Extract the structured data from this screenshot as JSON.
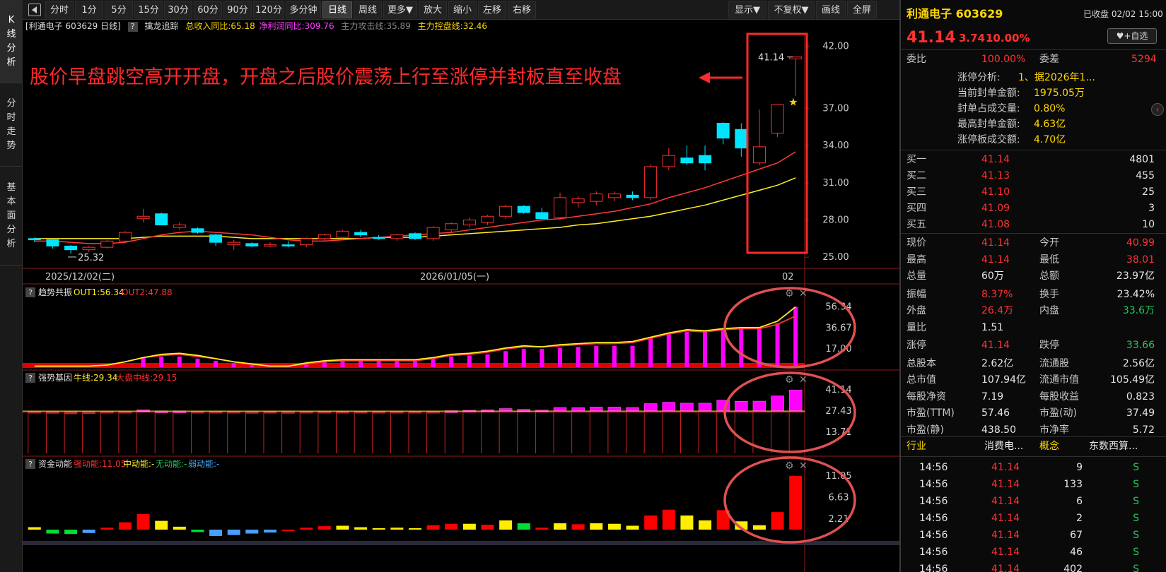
{
  "left_tabs": [
    {
      "label": "K线分析",
      "chars": [
        "K",
        "线",
        "分",
        "析"
      ]
    },
    {
      "label": "分时走势",
      "chars": [
        "分",
        "时",
        "走",
        "势"
      ]
    },
    {
      "label": "基本面分析",
      "chars": [
        "基",
        "本",
        "面",
        "分",
        "析"
      ]
    }
  ],
  "toolbar": {
    "periods": [
      "分时",
      "1分",
      "5分",
      "15分",
      "30分",
      "60分",
      "90分",
      "120分",
      "多分钟",
      "日线",
      "周线",
      "更多▼"
    ],
    "active_period": "日线",
    "actions": [
      "放大",
      "缩小",
      "左移",
      "右移"
    ],
    "right": [
      "显示▼",
      "不复权▼",
      "画线",
      "全屏"
    ]
  },
  "info_line": {
    "stock_tag": "[利通电子 603629 日线]",
    "indicator": "擒龙追踪",
    "revenue_yoy": "总收入同比:65.18",
    "profit_yoy": "净利润同比:309.76",
    "attack_line": "主力攻击线:35.89",
    "control_line": "主力控盘线:32.46"
  },
  "chart_annotations": {
    "headline": "股价早盘跳空高开开盘，开盘之后股价震荡上行至涨停并封板直至收盘",
    "last_price_label": "41.14",
    "low_label": "25.32"
  },
  "chart_data": [
    {
      "type": "candlestick",
      "name": "main",
      "ylim": [
        24.5,
        43
      ],
      "y_ticks": [
        42.0,
        37.0,
        34.0,
        31.0,
        28.0,
        25.0
      ],
      "x_labels": [
        "2025/12/02(二)",
        "2026/01/05(一)",
        "02"
      ],
      "candles": [
        [
          26.5,
          26.6,
          26.2,
          26.4
        ],
        [
          26.4,
          26.5,
          25.7,
          25.9
        ],
        [
          25.9,
          26.0,
          25.3,
          25.6
        ],
        [
          25.6,
          25.9,
          25.4,
          25.8
        ],
        [
          25.8,
          26.4,
          25.7,
          26.3
        ],
        [
          26.3,
          27.1,
          26.2,
          27.0
        ],
        [
          28.1,
          28.9,
          27.8,
          28.3
        ],
        [
          28.5,
          28.6,
          27.6,
          27.6
        ],
        [
          27.4,
          27.8,
          27.2,
          27.6
        ],
        [
          27.3,
          27.4,
          26.9,
          27.0
        ],
        [
          26.8,
          26.9,
          25.9,
          26.2
        ],
        [
          26.0,
          26.4,
          25.6,
          26.2
        ],
        [
          26.1,
          26.2,
          25.8,
          25.9
        ],
        [
          25.9,
          26.2,
          25.8,
          26.0
        ],
        [
          26.0,
          26.3,
          25.8,
          25.9
        ],
        [
          26.0,
          26.6,
          25.8,
          26.5
        ],
        [
          26.5,
          26.9,
          26.3,
          26.8
        ],
        [
          26.6,
          27.2,
          26.5,
          27.1
        ],
        [
          27.0,
          27.2,
          26.6,
          26.8
        ],
        [
          26.6,
          26.8,
          26.4,
          26.5
        ],
        [
          26.5,
          26.9,
          26.3,
          26.8
        ],
        [
          26.9,
          27.0,
          26.4,
          26.5
        ],
        [
          26.5,
          27.5,
          26.3,
          27.4
        ],
        [
          27.2,
          27.8,
          27.0,
          27.7
        ],
        [
          27.6,
          28.2,
          27.4,
          28.0
        ],
        [
          27.8,
          28.4,
          27.6,
          28.3
        ],
        [
          28.3,
          29.2,
          28.1,
          29.1
        ],
        [
          29.1,
          29.2,
          28.5,
          28.6
        ],
        [
          28.6,
          29.0,
          28.0,
          28.1
        ],
        [
          28.2,
          30.2,
          28.0,
          29.8
        ],
        [
          29.4,
          29.9,
          29.0,
          29.7
        ],
        [
          29.5,
          30.3,
          29.2,
          30.1
        ],
        [
          29.8,
          30.3,
          29.5,
          30.1
        ],
        [
          30.0,
          30.3,
          29.6,
          29.8
        ],
        [
          29.8,
          32.5,
          29.6,
          32.3
        ],
        [
          32.3,
          33.8,
          32.0,
          33.2
        ],
        [
          33.0,
          34.0,
          32.4,
          32.6
        ],
        [
          33.2,
          34.0,
          32.0,
          32.6
        ],
        [
          35.8,
          35.9,
          34.1,
          34.6
        ],
        [
          35.3,
          35.8,
          33.1,
          33.8
        ],
        [
          32.6,
          36.9,
          32.4,
          33.9
        ],
        [
          35.0,
          37.3,
          34.7,
          37.3
        ],
        [
          40.99,
          41.14,
          38.01,
          41.14
        ]
      ],
      "ma_red": [
        26.3,
        26.3,
        26.2,
        26.1,
        26.1,
        26.2,
        26.5,
        26.8,
        27.0,
        27.1,
        27.0,
        26.9,
        26.8,
        26.6,
        26.4,
        26.3,
        26.3,
        26.4,
        26.5,
        26.6,
        26.7,
        26.8,
        26.9,
        27.0,
        27.2,
        27.4,
        27.6,
        27.8,
        28.0,
        28.1,
        28.3,
        28.5,
        28.7,
        29.0,
        29.3,
        29.8,
        30.2,
        30.6,
        31.1,
        31.6,
        32.1,
        32.6,
        33.5,
        35.6
      ],
      "ma_yellow": [
        26.5,
        26.5,
        26.5,
        26.5,
        26.5,
        26.5,
        26.6,
        26.7,
        26.7,
        26.7,
        26.7,
        26.6,
        26.5,
        26.5,
        26.5,
        26.5,
        26.5,
        26.5,
        26.5,
        26.6,
        26.6,
        26.6,
        26.7,
        26.8,
        26.9,
        27.0,
        27.1,
        27.2,
        27.3,
        27.4,
        27.6,
        27.7,
        27.9,
        28.1,
        28.3,
        28.6,
        28.9,
        29.2,
        29.6,
        30.0,
        30.4,
        30.8,
        31.4,
        32.4
      ]
    },
    {
      "type": "bar",
      "name": "趋势共振",
      "ylim": [
        0,
        62
      ],
      "y_ticks": [
        "56.34",
        "36.67",
        "17.00"
      ],
      "out1_label": "OUT1:56.34",
      "out2_label": "OUT2:47.88",
      "values": [
        0,
        0,
        0,
        0,
        0,
        0,
        9,
        10,
        10,
        8,
        6,
        4,
        2,
        1,
        1,
        3,
        5,
        6,
        6,
        6,
        6,
        6,
        8,
        10,
        11,
        12,
        15,
        17,
        17,
        18,
        19,
        20,
        20,
        20,
        27,
        32,
        33,
        33,
        36,
        37,
        37,
        41,
        56.34
      ],
      "out1": [
        1,
        1,
        1,
        1,
        2,
        5,
        9,
        12,
        13,
        11,
        8,
        5,
        3,
        1,
        1,
        4,
        6,
        7,
        7,
        7,
        7,
        7,
        9,
        12,
        13,
        15,
        18,
        20,
        19,
        21,
        22,
        23,
        23,
        24,
        28,
        32,
        35,
        34,
        36,
        37,
        37,
        43,
        56.34
      ],
      "out2": [
        1,
        1,
        1,
        1,
        2,
        5,
        9,
        11,
        12,
        10,
        8,
        5,
        3,
        1,
        1,
        3,
        5,
        6,
        6,
        6,
        6,
        6,
        8,
        11,
        12,
        14,
        17,
        19,
        19,
        20,
        21,
        22,
        22,
        23,
        27,
        31,
        34,
        33,
        35,
        36,
        36,
        40,
        47.88
      ]
    },
    {
      "type": "bar",
      "name": "强势基因",
      "ylim": [
        0,
        44
      ],
      "y_ticks": [
        "41.14",
        "27.43",
        "13.71"
      ],
      "bull_label": "牛线:29.34",
      "market_label": "大盘中线:29.15",
      "values": [
        26.4,
        25.9,
        25.6,
        25.8,
        26.3,
        27.0,
        28.3,
        27.6,
        27.6,
        27.0,
        26.2,
        26.2,
        25.9,
        26.0,
        25.9,
        26.5,
        26.8,
        27.1,
        26.8,
        26.5,
        26.8,
        26.5,
        27.4,
        27.7,
        28.0,
        28.3,
        29.1,
        28.6,
        28.1,
        29.8,
        29.7,
        30.1,
        30.1,
        29.8,
        32.3,
        33.2,
        32.6,
        32.6,
        34.6,
        33.8,
        33.9,
        37.3,
        41.14
      ]
    },
    {
      "type": "bar",
      "name": "资金动能",
      "ylim": [
        0,
        11.6
      ],
      "y_ticks": [
        "11.05",
        "6.63",
        "2.21"
      ],
      "strong_label": "强动能:11.05",
      "mid_label": "中动能:-",
      "none_label": "无动能:-",
      "weak_label": "弱动能:-",
      "values": [
        0.5,
        -0.8,
        -0.9,
        -0.7,
        0.4,
        1.5,
        3.2,
        1.8,
        0.6,
        -0.5,
        -1.3,
        -1.1,
        -0.8,
        -0.6,
        -0.2,
        0.4,
        0.7,
        0.8,
        0.5,
        0.3,
        0.4,
        0.3,
        0.9,
        1.2,
        1.2,
        1.0,
        1.9,
        1.3,
        0.4,
        1.3,
        1.1,
        1.3,
        1.2,
        0.8,
        2.9,
        4.1,
        2.9,
        1.9,
        4.0,
        1.7,
        0.9,
        3.6,
        11.05
      ],
      "colors": [
        "y",
        "g",
        "g",
        "b",
        "r",
        "r",
        "r",
        "y",
        "y",
        "g",
        "b",
        "b",
        "b",
        "b",
        "r",
        "r",
        "r",
        "y",
        "y",
        "y",
        "y",
        "y",
        "r",
        "r",
        "y",
        "r",
        "y",
        "g",
        "r",
        "y",
        "r",
        "y",
        "y",
        "y",
        "r",
        "r",
        "y",
        "y",
        "r",
        "y",
        "y",
        "r",
        "r"
      ]
    }
  ],
  "right_panel": {
    "name_code": "利通电子 603629",
    "status": "已收盘 02/02 15:00",
    "price": "41.14",
    "change": "3.74",
    "change_pct": "10.00%",
    "zixuan": "+自选",
    "weibi_label": "委比",
    "weibi": "100.00%",
    "weicha_label": "委差",
    "weicha": "5294",
    "limit_info": [
      {
        "label": "涨停分析:",
        "value": "1、据2026年1..."
      },
      {
        "label": "当前封单金额:",
        "value": "1975.05万"
      },
      {
        "label": "封单占成交量:",
        "value": "0.80%"
      },
      {
        "label": "最高封单金额:",
        "value": "4.63亿"
      },
      {
        "label": "涨停板成交额:",
        "value": "4.70亿"
      }
    ],
    "bids": [
      {
        "label": "买一",
        "price": "41.14",
        "vol": "4801"
      },
      {
        "label": "买二",
        "price": "41.13",
        "vol": "455"
      },
      {
        "label": "买三",
        "price": "41.10",
        "vol": "25"
      },
      {
        "label": "买四",
        "price": "41.09",
        "vol": "3"
      },
      {
        "label": "买五",
        "price": "41.08",
        "vol": "10"
      }
    ],
    "stats": [
      {
        "l1": "现价",
        "v1": "41.14",
        "c1": "red",
        "l2": "今开",
        "v2": "40.99",
        "c2": "red"
      },
      {
        "l1": "最高",
        "v1": "41.14",
        "c1": "red",
        "l2": "最低",
        "v2": "38.01",
        "c2": "red"
      },
      {
        "l1": "总量",
        "v1": "60万",
        "c1": "white",
        "l2": "总额",
        "v2": "23.97亿",
        "c2": "white"
      },
      {
        "l1": "振幅",
        "v1": "8.37%",
        "c1": "red",
        "l2": "换手",
        "v2": "23.42%",
        "c2": "white"
      },
      {
        "l1": "外盘",
        "v1": "26.4万",
        "c1": "red",
        "l2": "内盘",
        "v2": "33.6万",
        "c2": "green"
      },
      {
        "l1": "量比",
        "v1": "1.51",
        "c1": "white",
        "l2": "",
        "v2": "",
        "c2": "white"
      },
      {
        "l1": "涨停",
        "v1": "41.14",
        "c1": "red",
        "l2": "跌停",
        "v2": "33.66",
        "c2": "green"
      },
      {
        "l1": "总股本",
        "v1": "2.62亿",
        "c1": "white",
        "l2": "流通股",
        "v2": "2.56亿",
        "c2": "white"
      },
      {
        "l1": "总市值",
        "v1": "107.94亿",
        "c1": "white",
        "l2": "流通市值",
        "v2": "105.49亿",
        "c2": "white"
      },
      {
        "l1": "每股净资",
        "v1": "7.19",
        "c1": "white",
        "l2": "每股收益",
        "v2": "0.823",
        "c2": "white"
      },
      {
        "l1": "市盈(TTM)",
        "v1": "57.46",
        "c1": "white",
        "l2": "市盈(动)",
        "v2": "37.49",
        "c2": "white"
      },
      {
        "l1": "市盈(静)",
        "v1": "438.50",
        "c1": "white",
        "l2": "市净率",
        "v2": "5.72",
        "c2": "white"
      }
    ],
    "industry_label": "行业",
    "industry": "消费电...",
    "concept_label": "概念",
    "concept": "东数西算...",
    "ticks": [
      {
        "time": "14:56",
        "price": "41.14",
        "vol": "9",
        "side": "S"
      },
      {
        "time": "14:56",
        "price": "41.14",
        "vol": "133",
        "side": "S"
      },
      {
        "time": "14:56",
        "price": "41.14",
        "vol": "6",
        "side": "S"
      },
      {
        "time": "14:56",
        "price": "41.14",
        "vol": "2",
        "side": "S"
      },
      {
        "time": "14:56",
        "price": "41.14",
        "vol": "67",
        "side": "S"
      },
      {
        "time": "14:56",
        "price": "41.14",
        "vol": "46",
        "side": "S"
      },
      {
        "time": "14:56",
        "price": "41.14",
        "vol": "402",
        "side": "S"
      }
    ]
  }
}
